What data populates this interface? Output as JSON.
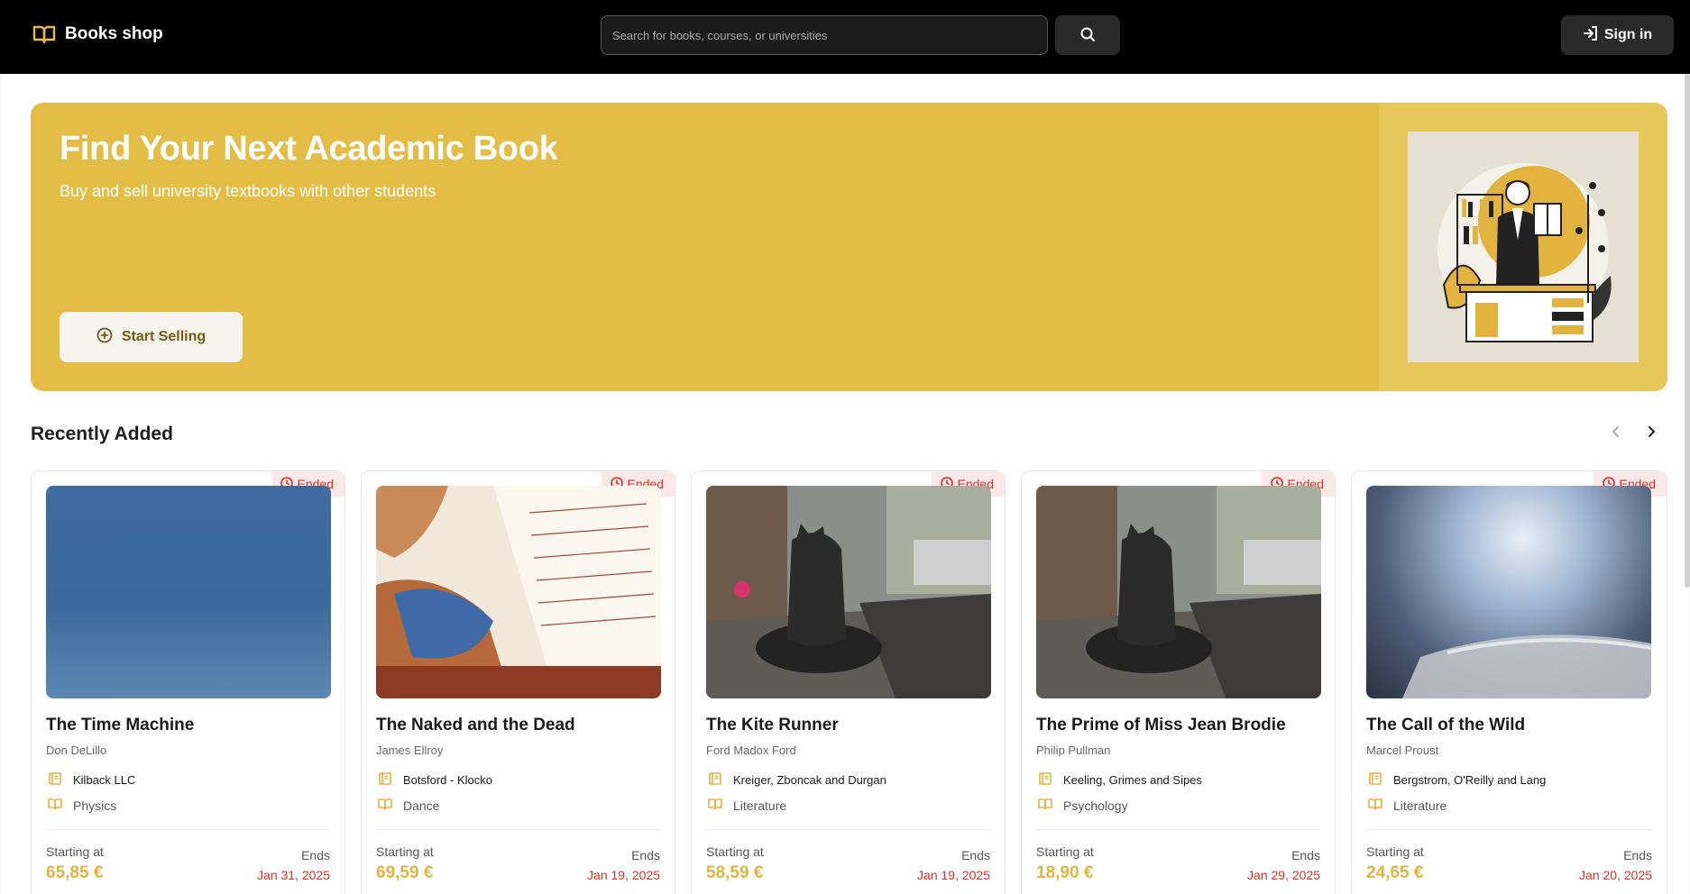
{
  "header": {
    "logo_text": "Books shop",
    "search_placeholder": "Search for books, courses, or universities",
    "signin_label": "Sign in"
  },
  "colors": {
    "accent": "#e3bd45",
    "header_bg": "#000000",
    "ended": "#d93025",
    "price": "#e3b33f"
  },
  "hero": {
    "title": "Find Your Next Academic Book",
    "subtitle": "Buy and sell university textbooks with other students",
    "cta_label": "Start Selling"
  },
  "recent": {
    "title": "Recently Added",
    "cards": [
      {
        "badge": "Ended",
        "title": "The Time Machine",
        "author": "Don DeLillo",
        "university": "Kilback LLC",
        "subject": "Physics",
        "starting_label": "Starting at",
        "price": "65,85 €",
        "ends_label": "Ends",
        "ends_date": "Jan 31, 2025",
        "image": "blue-blur"
      },
      {
        "badge": "Ended",
        "title": "The Naked and the Dead",
        "author": "James Ellroy",
        "university": "Botsford - Klocko",
        "subject": "Dance",
        "starting_label": "Starting at",
        "price": "69,59 €",
        "ends_label": "Ends",
        "ends_date": "Jan 19, 2025",
        "image": "sheet-music-painting"
      },
      {
        "badge": "Ended",
        "title": "The Kite Runner",
        "author": "Ford Madox Ford",
        "university": "Kreiger, Zboncak and Durgan",
        "subject": "Literature",
        "starting_label": "Starting at",
        "price": "58,59 €",
        "ends_label": "Ends",
        "ends_date": "Jan 19, 2025",
        "image": "cat-statue-street"
      },
      {
        "badge": "Ended",
        "title": "The Prime of Miss Jean Brodie",
        "author": "Philip Pullman",
        "university": "Keeling, Grimes and Sipes",
        "subject": "Psychology",
        "starting_label": "Starting at",
        "price": "18,90 €",
        "ends_label": "Ends",
        "ends_date": "Jan 29, 2025",
        "image": "cat-statue-street"
      },
      {
        "badge": "Ended",
        "title": "The Call of the Wild",
        "author": "Marcel Proust",
        "university": "Bergstrom, O'Reilly and Lang",
        "subject": "Literature",
        "starting_label": "Starting at",
        "price": "24,65 €",
        "ends_label": "Ends",
        "ends_date": "Jan 20, 2025",
        "image": "phone-blur"
      }
    ]
  }
}
